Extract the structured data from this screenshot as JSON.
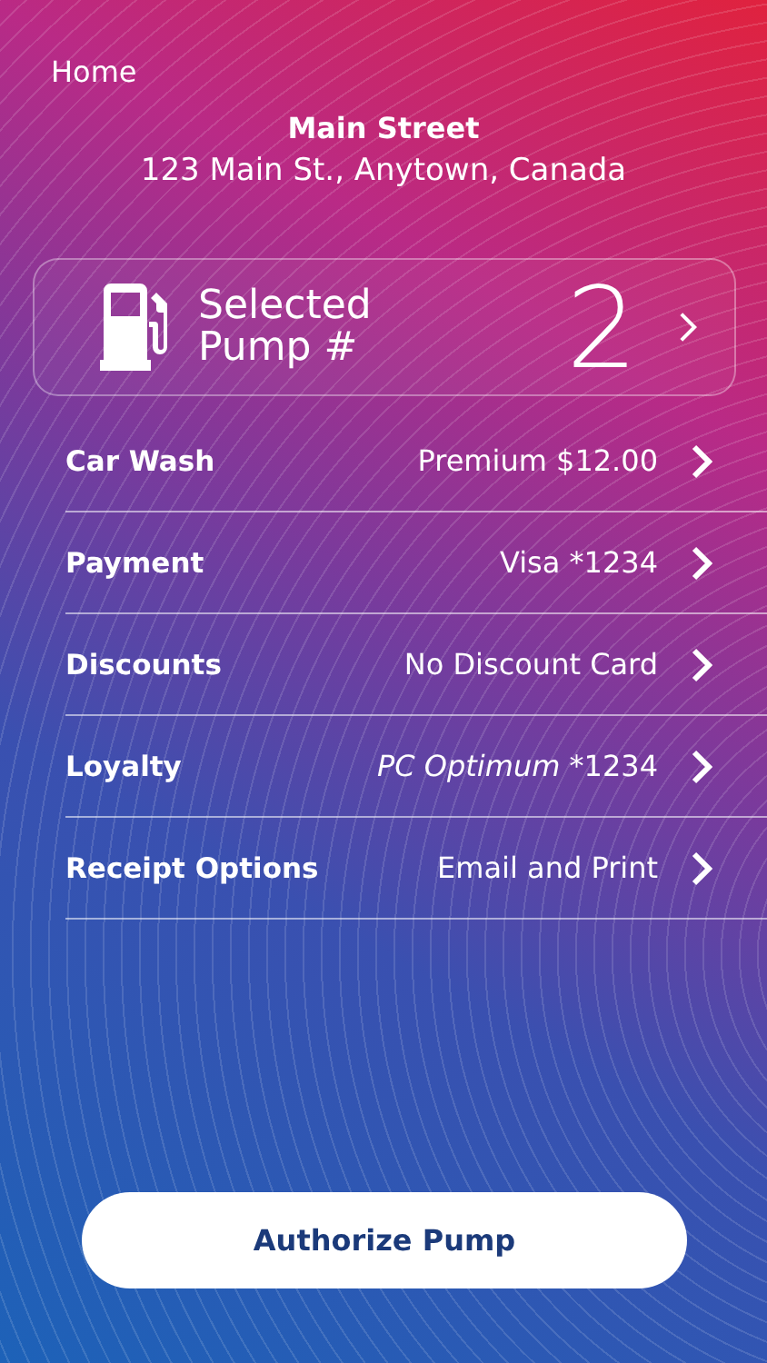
{
  "nav": {
    "back": "Home"
  },
  "station": {
    "name": "Main Street",
    "address": "123 Main St., Anytown, Canada"
  },
  "pump": {
    "label": "Selected\nPump #",
    "number": "2"
  },
  "options": [
    {
      "label": "Car Wash",
      "value": "Premium $12.00"
    },
    {
      "label": "Payment",
      "value": "Visa *1234"
    },
    {
      "label": "Discounts",
      "value": "No Discount Card"
    },
    {
      "label": "Loyalty",
      "brand": "PC Optimum",
      "value": "*1234"
    },
    {
      "label": "Receipt Options",
      "value": "Email and Print"
    }
  ],
  "action": {
    "label": "Authorize Pump"
  }
}
